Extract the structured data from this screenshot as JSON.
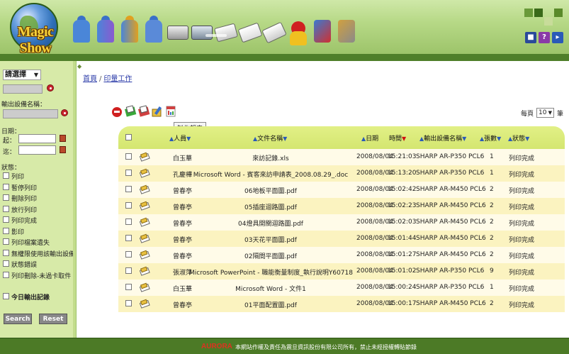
{
  "app": {
    "logo_text": "Magic Show"
  },
  "nav": {
    "icons": [
      "user-icon",
      "users-group-icon",
      "user-settings-icon",
      "people-icon",
      "printer-icon",
      "scanner-icon",
      "print-job-icon",
      "document-icon",
      "copy-icon",
      "quota-icon",
      "system-tools-icon",
      "tools-icon"
    ]
  },
  "header_right": {
    "icons": [
      "lock-icon",
      "help-icon",
      "exit-icon"
    ]
  },
  "sidebar": {
    "select_value": "請選擇",
    "device_name_label": "輸出設備名稱：",
    "date_label": "日期：",
    "from_label": "起：",
    "to_label": "迄：",
    "status_label": "狀態：",
    "statuses": [
      "列印",
      "暫停列印",
      "刪除列印",
      "放行列印",
      "列印完成",
      "影印",
      "列印檔案遺失",
      "無權限使用該輸出設備",
      "狀態錯誤",
      "列印刪除-未過卡取件"
    ],
    "today_label": "今日輸出記錄",
    "search_button": "Search",
    "reset_button": "Reset"
  },
  "breadcrumb": {
    "home": "首頁",
    "separator": "/",
    "current": "印量工作"
  },
  "toolbar": {
    "icons": [
      "delete-icon",
      "release-icon",
      "pause-icon",
      "edit-icon",
      "report-icon"
    ],
    "tooltip": "製作報表"
  },
  "pagination": {
    "per_page_label": "每頁",
    "per_page_value": "10",
    "unit": "筆"
  },
  "table": {
    "headers": {
      "user": "人員",
      "filename": "文件名稱",
      "date": "日期",
      "time": "時間",
      "device": "輸出設備名稱",
      "pages": "張數",
      "status": "狀態"
    },
    "rows": [
      {
        "user": "白玉華",
        "filename": "來訪記錄.xls",
        "date": "2008/08/04",
        "time": "15:21:03",
        "device": "SHARP AR-P350 PCL6",
        "pages": "1",
        "status": "列印完成"
      },
      {
        "user": "孔慶樺",
        "filename": "Microsoft Word - 賓客來訪申請表_2008.08.29_.doc",
        "date": "2008/08/04",
        "time": "15:13:20",
        "device": "SHARP AR-P350 PCL6",
        "pages": "1",
        "status": "列印完成"
      },
      {
        "user": "曾春亭",
        "filename": "06地板平面圖.pdf",
        "date": "2008/08/04",
        "time": "15:02:42",
        "device": "SHARP AR-M450 PCL6",
        "pages": "2",
        "status": "列印完成"
      },
      {
        "user": "曾春亭",
        "filename": "05插座迴路圖.pdf",
        "date": "2008/08/04",
        "time": "15:02:23",
        "device": "SHARP AR-M450 PCL6",
        "pages": "2",
        "status": "列印完成"
      },
      {
        "user": "曾春亭",
        "filename": "04燈具開關迴路圖.pdf",
        "date": "2008/08/04",
        "time": "15:02:03",
        "device": "SHARP AR-M450 PCL6",
        "pages": "2",
        "status": "列印完成"
      },
      {
        "user": "曾春亭",
        "filename": "03天花平面圖.pdf",
        "date": "2008/08/04",
        "time": "15:01:44",
        "device": "SHARP AR-M450 PCL6",
        "pages": "2",
        "status": "列印完成"
      },
      {
        "user": "曾春亭",
        "filename": "02隔間平面圖.pdf",
        "date": "2008/08/04",
        "time": "15:01:27",
        "device": "SHARP AR-M450 PCL6",
        "pages": "2",
        "status": "列印完成"
      },
      {
        "user": "張淑萍",
        "filename": "Microsoft PowerPoint - 職能衡量制度_執行說明Y60718",
        "date": "2008/08/04",
        "time": "15:01:02",
        "device": "SHARP AR-P350 PCL6",
        "pages": "9",
        "status": "列印完成"
      },
      {
        "user": "白玉華",
        "filename": "Microsoft Word - 文件1",
        "date": "2008/08/04",
        "time": "15:00:24",
        "device": "SHARP AR-P350 PCL6",
        "pages": "1",
        "status": "列印完成"
      },
      {
        "user": "曾春亭",
        "filename": "01平面配置圖.pdf",
        "date": "2008/08/04",
        "time": "15:00:17",
        "device": "SHARP AR-M450 PCL6",
        "pages": "2",
        "status": "列印完成"
      }
    ]
  },
  "footer": {
    "brand": "AURORA",
    "copyright": "本網站作權及責任為震旦資訊股份有限公司所有，禁止未經授權轉貼節錄"
  },
  "colors": {
    "header_green": "#9dc46a",
    "table_header": "#d4e670",
    "row_alt": "#fbf3c0",
    "footer": "#4c7a26"
  }
}
